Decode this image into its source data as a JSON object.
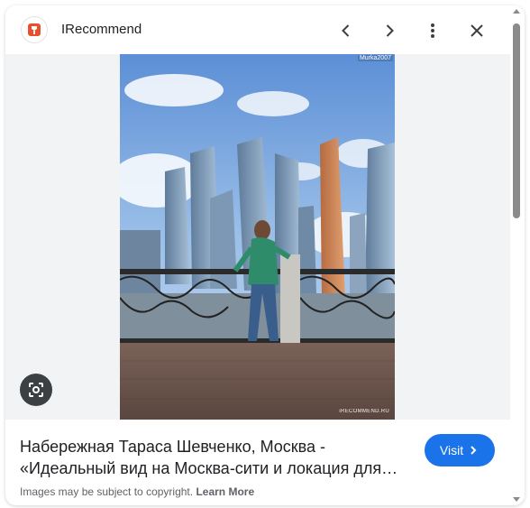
{
  "header": {
    "site_name": "IRecommend",
    "logo_icon": "irecommend-logo-icon",
    "accent_color": "#e8502c",
    "buttons": [
      "chevron-left-icon",
      "chevron-right-icon",
      "more-vert-icon",
      "close-icon"
    ]
  },
  "image": {
    "watermark_top": "Murka2007",
    "watermark_bottom": "iRECOMMEND.RU",
    "lens_icon": "lens-search-icon"
  },
  "info": {
    "title_line1": "Набережная Тараса Шевченко, Москва -",
    "title_line2": "«Идеальный вид на Москва-сити и локация для…",
    "visit_label": "Visit",
    "visit_color": "#1a73e8",
    "copyright_text": "Images may be subject to copyright. ",
    "learn_more": "Learn More"
  }
}
